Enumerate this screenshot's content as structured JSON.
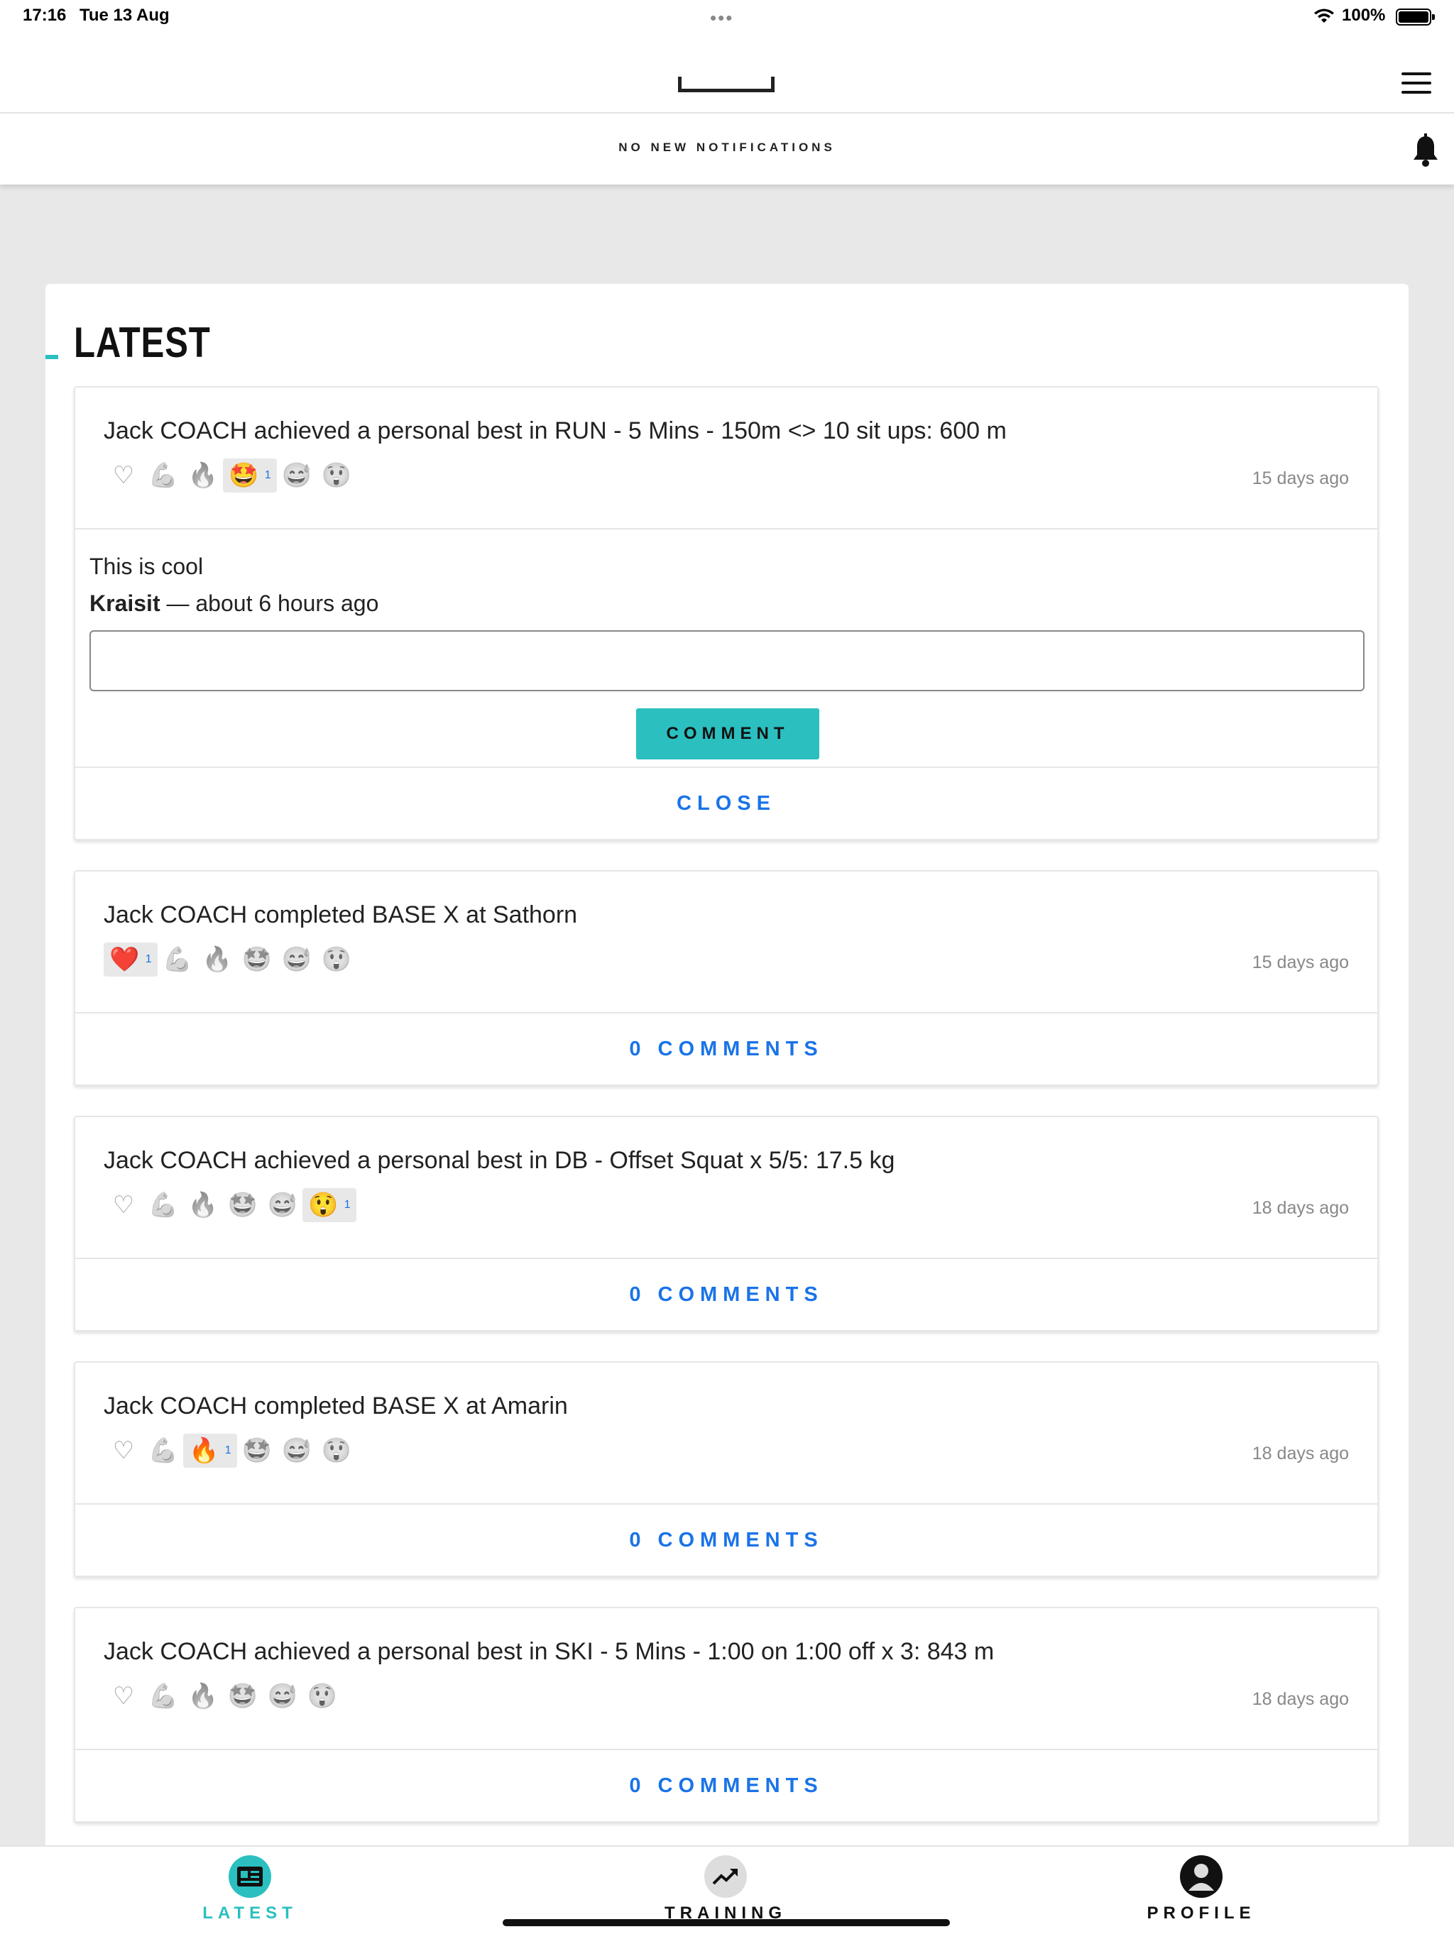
{
  "status_bar": {
    "time": "17:16",
    "date": "Tue 13 Aug",
    "battery": "100%"
  },
  "notifications": {
    "text": "NO NEW NOTIFICATIONS"
  },
  "section": {
    "title": "LATEST"
  },
  "feed": [
    {
      "title": "Jack COACH achieved a personal best in RUN - 5 Mins - 150m <> 10 sit ups: 600 m",
      "time": "15 days ago",
      "reactions": [
        {
          "icon": "heart-icon",
          "glyph": "♡",
          "count": ""
        },
        {
          "icon": "muscle-icon",
          "glyph": "💪",
          "count": ""
        },
        {
          "icon": "fire-icon",
          "glyph": "🔥",
          "count": ""
        },
        {
          "icon": "star-eyes-icon",
          "glyph": "🤩",
          "count": "1"
        },
        {
          "icon": "sweat-face-icon",
          "glyph": "😅",
          "count": ""
        },
        {
          "icon": "surprised-face-icon",
          "glyph": "😲",
          "count": ""
        }
      ],
      "comment": {
        "text": "This is cool",
        "author": "Kraisit",
        "meta": " — about 6 hours ago",
        "button": "COMMENT"
      },
      "footer": "CLOSE"
    },
    {
      "title": "Jack COACH completed BASE X at Sathorn",
      "time": "15 days ago",
      "reactions": [
        {
          "icon": "heart-icon",
          "glyph": "❤️",
          "count": "1"
        },
        {
          "icon": "muscle-icon",
          "glyph": "💪",
          "count": ""
        },
        {
          "icon": "fire-icon",
          "glyph": "🔥",
          "count": ""
        },
        {
          "icon": "star-eyes-icon",
          "glyph": "🤩",
          "count": ""
        },
        {
          "icon": "sweat-face-icon",
          "glyph": "😅",
          "count": ""
        },
        {
          "icon": "surprised-face-icon",
          "glyph": "😲",
          "count": ""
        }
      ],
      "footer": "0 COMMENTS"
    },
    {
      "title": "Jack COACH achieved a personal best in DB - Offset Squat x 5/5: 17.5 kg",
      "time": "18 days ago",
      "reactions": [
        {
          "icon": "heart-icon",
          "glyph": "♡",
          "count": ""
        },
        {
          "icon": "muscle-icon",
          "glyph": "💪",
          "count": ""
        },
        {
          "icon": "fire-icon",
          "glyph": "🔥",
          "count": ""
        },
        {
          "icon": "star-eyes-icon",
          "glyph": "🤩",
          "count": ""
        },
        {
          "icon": "sweat-face-icon",
          "glyph": "😅",
          "count": ""
        },
        {
          "icon": "surprised-face-icon",
          "glyph": "😲",
          "count": "1"
        }
      ],
      "footer": "0 COMMENTS"
    },
    {
      "title": "Jack COACH completed BASE X at Amarin",
      "time": "18 days ago",
      "reactions": [
        {
          "icon": "heart-icon",
          "glyph": "♡",
          "count": ""
        },
        {
          "icon": "muscle-icon",
          "glyph": "💪",
          "count": ""
        },
        {
          "icon": "fire-icon",
          "glyph": "🔥",
          "count": "1"
        },
        {
          "icon": "star-eyes-icon",
          "glyph": "🤩",
          "count": ""
        },
        {
          "icon": "sweat-face-icon",
          "glyph": "😅",
          "count": ""
        },
        {
          "icon": "surprised-face-icon",
          "glyph": "😲",
          "count": ""
        }
      ],
      "footer": "0 COMMENTS"
    },
    {
      "title": "Jack COACH achieved a personal best in SKI - 5 Mins - 1:00 on 1:00 off x 3: 843 m",
      "time": "18 days ago",
      "reactions": [
        {
          "icon": "heart-icon",
          "glyph": "♡",
          "count": ""
        },
        {
          "icon": "muscle-icon",
          "glyph": "💪",
          "count": ""
        },
        {
          "icon": "fire-icon",
          "glyph": "🔥",
          "count": ""
        },
        {
          "icon": "star-eyes-icon",
          "glyph": "🤩",
          "count": ""
        },
        {
          "icon": "sweat-face-icon",
          "glyph": "😅",
          "count": ""
        },
        {
          "icon": "surprised-face-icon",
          "glyph": "😲",
          "count": ""
        }
      ],
      "footer": "0 COMMENTS"
    }
  ],
  "bottom_nav": [
    {
      "label": "LATEST",
      "icon": "newspaper-icon",
      "active": true
    },
    {
      "label": "TRAINING",
      "icon": "trending-up-icon",
      "active": false
    },
    {
      "label": "PROFILE",
      "icon": "user-icon",
      "active": false
    }
  ],
  "colors": {
    "accent": "#2bbfc0",
    "link": "#1a73e8",
    "active_nav": "#2bbfc0"
  }
}
